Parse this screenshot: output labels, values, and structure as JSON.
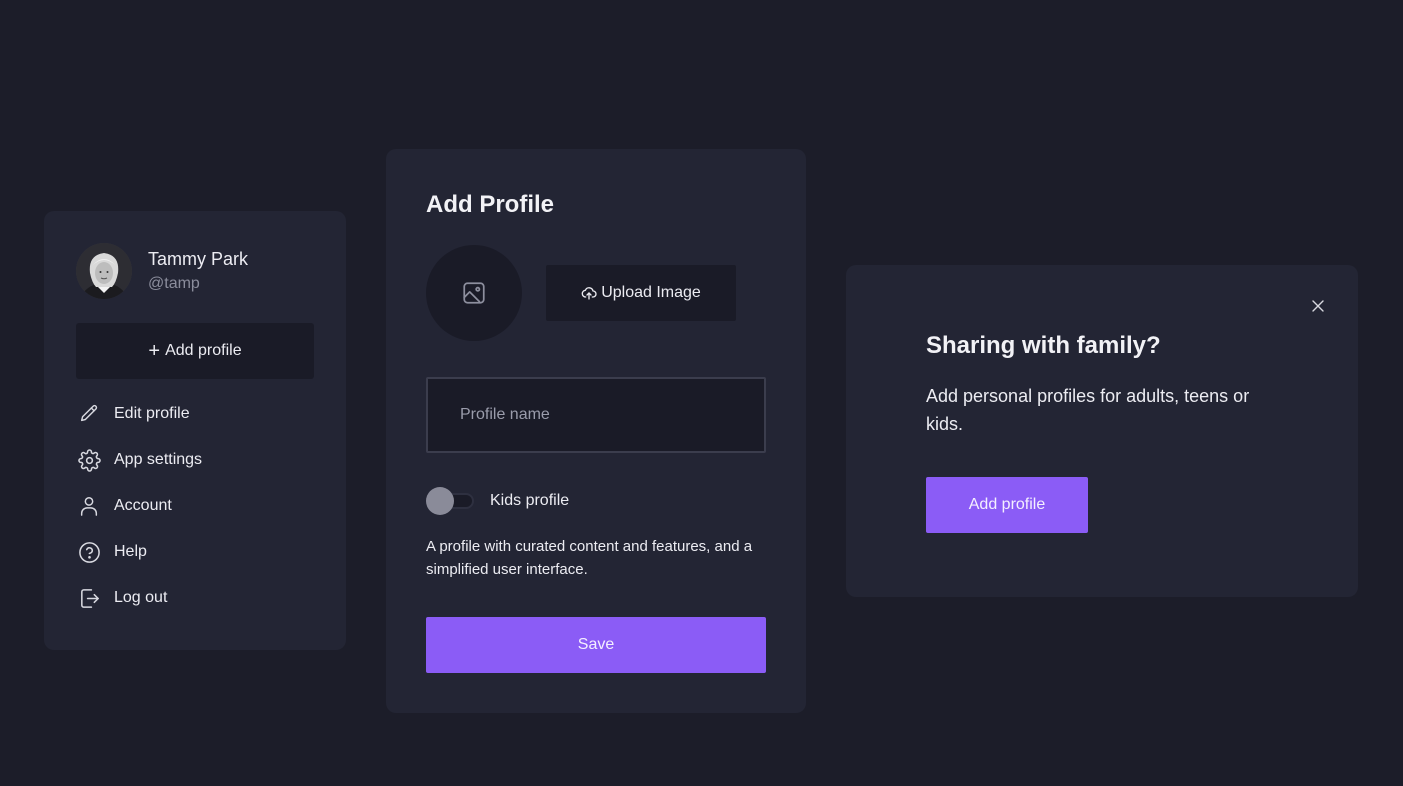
{
  "user": {
    "name": "Tammy Park",
    "handle": "@tamp"
  },
  "sidebar": {
    "add_profile_label": "Add profile",
    "items": [
      {
        "label": "Edit profile",
        "icon": "pencil-icon"
      },
      {
        "label": "App settings",
        "icon": "gear-icon"
      },
      {
        "label": "Account",
        "icon": "user-icon"
      },
      {
        "label": "Help",
        "icon": "help-circle-icon"
      },
      {
        "label": "Log out",
        "icon": "log-out-icon"
      }
    ]
  },
  "add_profile_card": {
    "title": "Add Profile",
    "upload_label": "Upload Image",
    "name_placeholder": "Profile name",
    "name_value": "",
    "kids_toggle_label": "Kids profile",
    "kids_toggle_on": false,
    "kids_description": "A profile with curated content and features, and a simplified user interface.",
    "save_label": "Save"
  },
  "sharing_card": {
    "title": "Sharing with family?",
    "description": "Add personal profiles for adults, teens or kids.",
    "button_label": "Add profile"
  },
  "colors": {
    "background": "#1c1d29",
    "card": "#232534",
    "field": "#1a1b27",
    "accent": "#8b5cf6"
  }
}
